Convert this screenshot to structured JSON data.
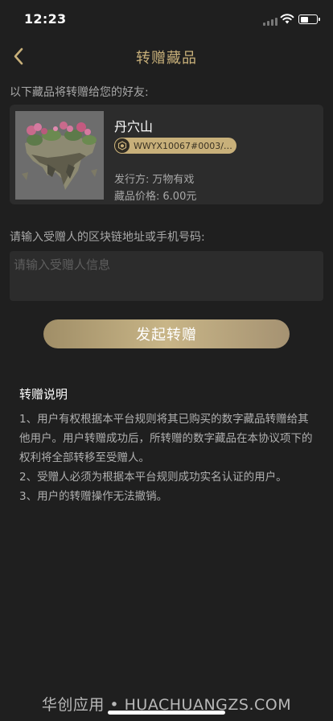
{
  "status_bar": {
    "time": "12:23"
  },
  "nav": {
    "title": "转赠藏品"
  },
  "friend_label": "以下藏品将转赠给您的好友:",
  "collection": {
    "name": "丹穴山",
    "token_id": "WWYX10067#0003/16...",
    "issuer_key": "发行方:",
    "issuer": "万物有戏",
    "price_key": "藏品价格:",
    "price": "6.00元"
  },
  "address_label": "请输入受赠人的区块链地址或手机号码:",
  "recipient_input": {
    "placeholder": "请输入受赠人信息",
    "value": ""
  },
  "transfer_button": "发起转赠",
  "instructions": {
    "title": "转赠说明",
    "items": [
      "1、用户有权根据本平台规则将其已购买的数字藏品转赠给其他用户。用户转赠成功后，所转赠的数字藏品在本协议项下的权利将全部转移至受赠人。",
      "2、受赠人必须为根据本平台规则成功实名认证的用户。",
      "3、用户的转赠操作无法撤销。"
    ]
  },
  "watermark": "华创应用 • HUACHUANGZS.COM",
  "colors": {
    "background": "#1f1f1f",
    "card": "#2c2c2c",
    "accent_gold": "#c8b07a",
    "muted_text": "#a8a8a8"
  },
  "icons": [
    "back-chevron-icon",
    "wifi-icon",
    "battery-icon",
    "signal-icon",
    "token-badge-icon"
  ]
}
